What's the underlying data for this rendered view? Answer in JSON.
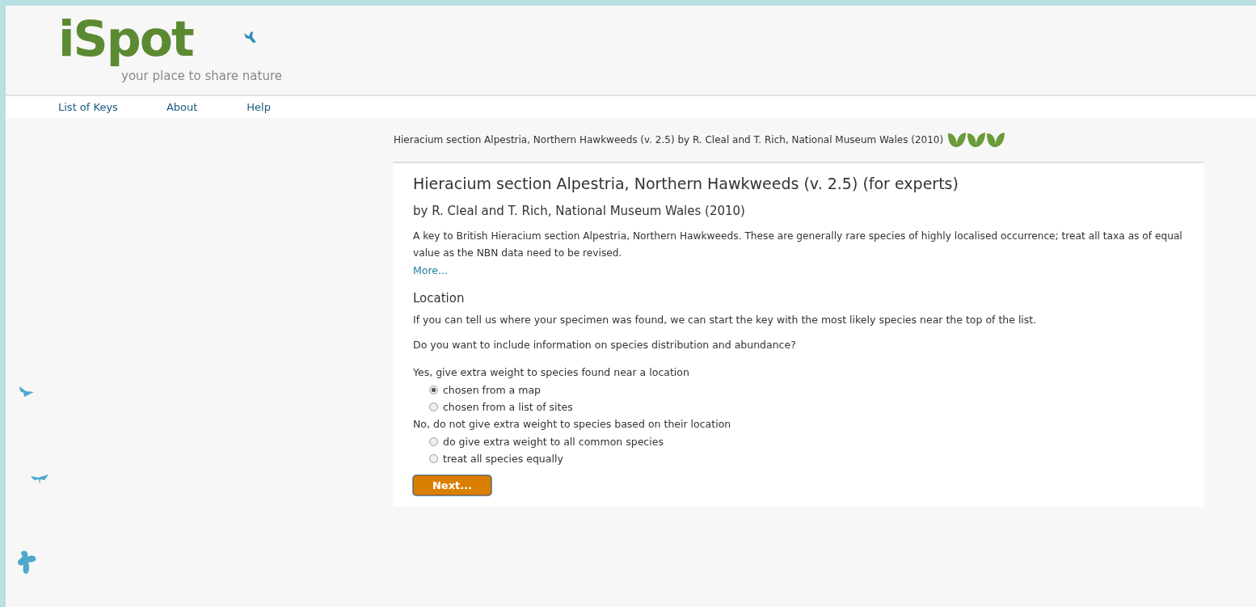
{
  "logo": {
    "name": "iSpot",
    "tagline": "your place to share nature"
  },
  "nav": [
    {
      "label": "List of Keys"
    },
    {
      "label": "About"
    },
    {
      "label": "Help"
    }
  ],
  "breadcrumb": {
    "text": "Hieracium section Alpestria, Northern Hawkweeds (v. 2.5) by R. Cleal and T. Rich, National Museum Wales (2010)",
    "stars": 3
  },
  "key": {
    "title": "Hieracium section Alpestria, Northern Hawkweeds (v. 2.5) (for experts)",
    "byline": "by R. Cleal and T. Rich, National Museum Wales (2010)",
    "description": "A key to British Hieracium section Alpestria, Northern Hawkweeds. These are generally rare species of highly localised occurrence; treat all taxa as of equal value as the NBN data need to be revised.",
    "more_link": "More..."
  },
  "location": {
    "heading": "Location",
    "intro": "If you can tell us where your specimen was found, we can start the key with the most likely species near the top of the list.",
    "question": "Do you want to include information on species distribution and abundance?",
    "groups": [
      {
        "label": "Yes, give extra weight to species found near a location",
        "options": [
          {
            "label": "chosen from a map",
            "selected": true
          },
          {
            "label": "chosen from a list of sites",
            "selected": false
          }
        ]
      },
      {
        "label": "No, do not give extra weight to species based on their location",
        "options": [
          {
            "label": "do give extra weight to all common species",
            "selected": false
          },
          {
            "label": "treat all species equally",
            "selected": false
          }
        ]
      }
    ],
    "next_button": "Next..."
  }
}
